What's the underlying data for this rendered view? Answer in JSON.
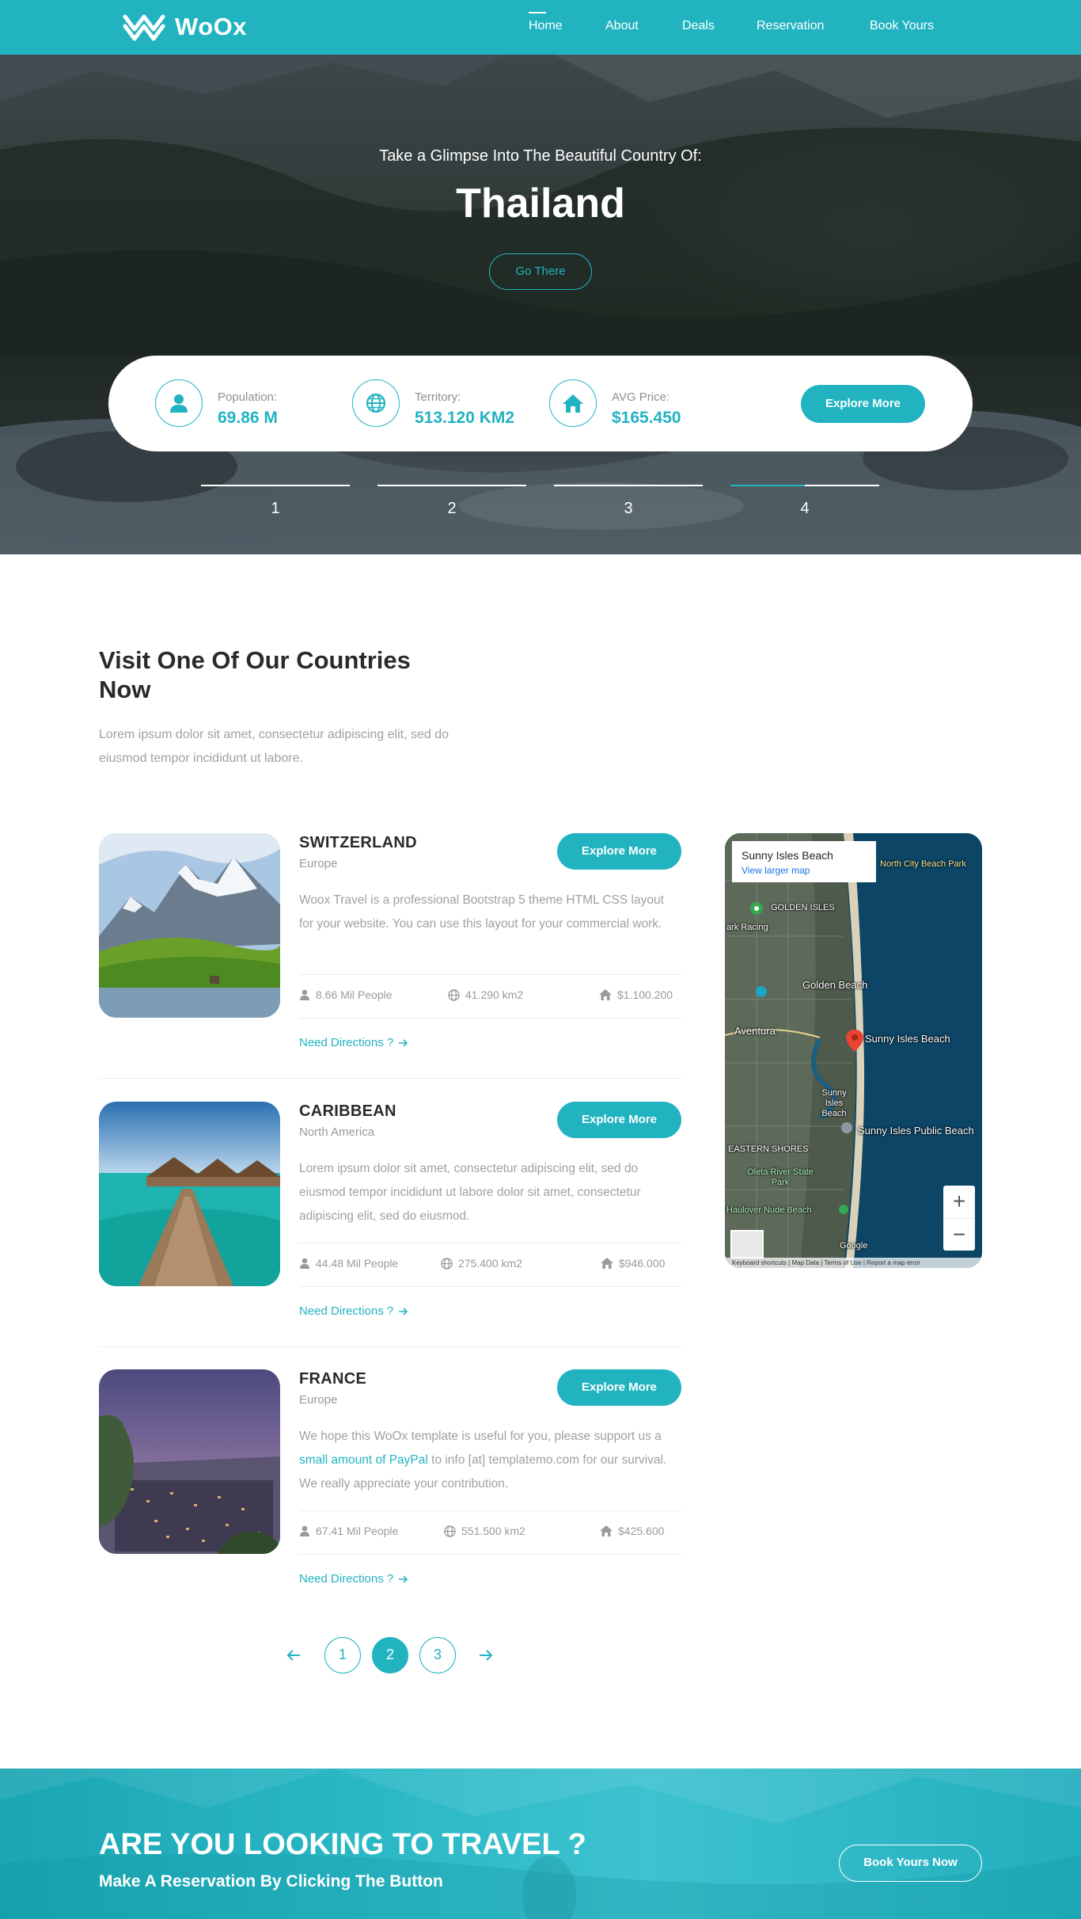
{
  "brand": {
    "name": "WoOx"
  },
  "nav": {
    "items": [
      "Home",
      "About",
      "Deals",
      "Reservation",
      "Book Yours"
    ]
  },
  "hero": {
    "subtitle": "Take a Glimpse Into The Beautiful Country Of:",
    "title": "Thailand",
    "cta": "Go There",
    "stats": [
      {
        "label": "Population:",
        "value": "69.86 M",
        "icon": "user-icon"
      },
      {
        "label": "Territory:",
        "value": "513.120 KM2",
        "icon": "globe-icon"
      },
      {
        "label": "AVG Price:",
        "value": "$165.450",
        "icon": "home-icon"
      }
    ],
    "explore": "Explore More",
    "slides": [
      "1",
      "2",
      "3",
      "4"
    ],
    "active_slide": 4
  },
  "countries_section": {
    "title": "Visit One Of Our Countries Now",
    "description": "Lorem ipsum dolor sit amet, consectetur adipiscing elit, sed do eiusmod tempor incididunt ut labore."
  },
  "countries": [
    {
      "name": "SWITZERLAND",
      "region": "Europe",
      "button": "Explore More",
      "text": "Woox Travel is a professional Bootstrap 5 theme HTML CSS layout for your website. You can use this layout for your commercial work.",
      "people": "8.66 Mil People",
      "area": "41.290 km2",
      "price": "$1.100.200",
      "directions": "Need Directions ?"
    },
    {
      "name": "CARIBBEAN",
      "region": "North America",
      "button": "Explore More",
      "text": "Lorem ipsum dolor sit amet, consectetur adipiscing elit, sed do eiusmod tempor incididunt ut labore dolor sit amet, consectetur adipiscing elit, sed do eiusmod.",
      "people": "44.48 Mil People",
      "area": "275.400 km2",
      "price": "$946.000",
      "directions": "Need Directions ?"
    },
    {
      "name": "FRANCE",
      "region": "Europe",
      "button": "Explore More",
      "text_before": "We hope this WoOx template is useful for you, please support us a ",
      "text_link": "small amount of PayPal",
      "text_after": " to info [at] templatemo.com for our survival. We really appreciate your contribution.",
      "people": "67.41 Mil People",
      "area": "551.500 km2",
      "price": "$425.600",
      "directions": "Need Directions ?"
    }
  ],
  "map": {
    "place": "Sunny Isles Beach",
    "link": "View larger map",
    "labels": {
      "north_city": "North City Beach Park",
      "golden_isles": "GOLDEN ISLES",
      "park_racing": "ark Racing",
      "golden_beach": "Golden Beach",
      "aventura": "Aventura",
      "sunny_isles": "Sunny Isles Beach",
      "sunny_isles_short": "Sunny Isles Beach",
      "public_beach": "Sunny Isles Public Beach",
      "eastern_shores": "EASTERN SHORES",
      "oleta": "Oleta River State Park",
      "haulover": "Haulover Nude Beach",
      "google": "Google"
    },
    "zoom_in": "+",
    "zoom_out": "−",
    "footer": "Keyboard shortcuts | Map Data | Terms of Use | Report a map error"
  },
  "pagination": {
    "pages": [
      "1",
      "2",
      "3"
    ],
    "active": 2
  },
  "cta": {
    "title": "ARE YOU LOOKING TO TRAVEL ?",
    "subtitle": "Make A Reservation By Clicking The Button",
    "button": "Book Yours Now"
  },
  "colors": {
    "accent": "#22b3c1",
    "text": "#2a2a2a",
    "muted": "#a0a0a0"
  }
}
